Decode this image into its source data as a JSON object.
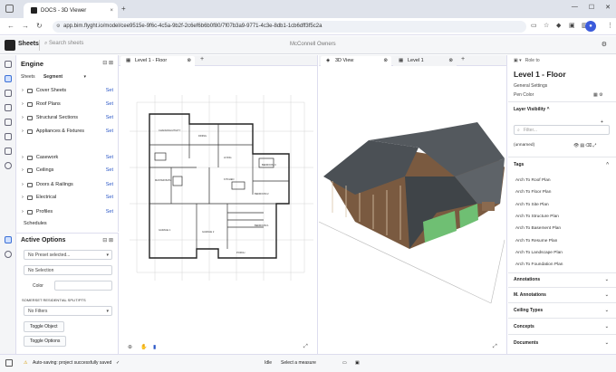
{
  "browser": {
    "tab_title": "DOCS - 3D Viewer",
    "tab_close": "×",
    "new_tab": "+",
    "url": "app.bim.flyght.io/model/cee9515e-9f6c-4c5a-9b2f-2c6ef6b6b0f80/7f07b3a9-9771-4c3e-8db1-1cb6dff3f5c2a"
  },
  "header": {
    "app_title": "Sheets",
    "search_placeholder": "Search sheets",
    "breadcrumb": "McConnell   Owners"
  },
  "engine": {
    "title": "Engine",
    "sheets_label": "Sheets",
    "sheets_value": "Segment",
    "set_label": "Set",
    "categories": [
      "Cover Sheets",
      "Roof Plans",
      "Structural Sections",
      "Appliances & Fixtures",
      "Casework",
      "Ceilings",
      "Doors & Railings",
      "Electrical",
      "Profiles"
    ],
    "schedules": "Schedules"
  },
  "active_options": {
    "title": "Active Options",
    "preset": "No Preset selected...",
    "selection": "No Selection",
    "color_label": "Color",
    "section_label": "SOMERSET RESIDENTIAL SPLIT/PTS",
    "filters": "No Filters",
    "toggle_object": "Toggle Object",
    "toggle_options": "Toggle Options"
  },
  "viewer1": {
    "tab": "Level 1 - Floor",
    "rooms": [
      "CHANGING/UTILITY",
      "DINING",
      "BEDROOM 3",
      "LIVING",
      "BEDROOM 2",
      "GARAGE 1",
      "GARAGE 2",
      "BEDROOM 1",
      "PORCH",
      "MASTER BATH",
      "KITCHEN"
    ]
  },
  "viewer2": {
    "tab_3d": "3D View",
    "tab_level": "Level 1"
  },
  "right_panel": {
    "top_label": "Role to",
    "title": "Level 1 - Floor",
    "general_settings": "General Settings",
    "pen_color": "Pen Color",
    "layer_visibility": "Layer Visibility",
    "filter_placeholder": "Filter...",
    "layer_name": "(unnamed)",
    "tags_label": "Tags",
    "tags": [
      "Arch To Roof Plan",
      "Arch To Floor Plan",
      "Arch To Site Plan",
      "Arch To Structure Plan",
      "Arch To Basement Plan",
      "Arch To Resume Plan",
      "Arch To Landscape Plan",
      "Arch To Foundation Plan"
    ],
    "sections": [
      "Annotations",
      "M. Annotations",
      "Ceiling Types",
      "Concepts",
      "Documents"
    ]
  },
  "status": {
    "message": "Auto-saving: project successfully saved",
    "mode": "Idle",
    "measure": "Select a measure"
  }
}
